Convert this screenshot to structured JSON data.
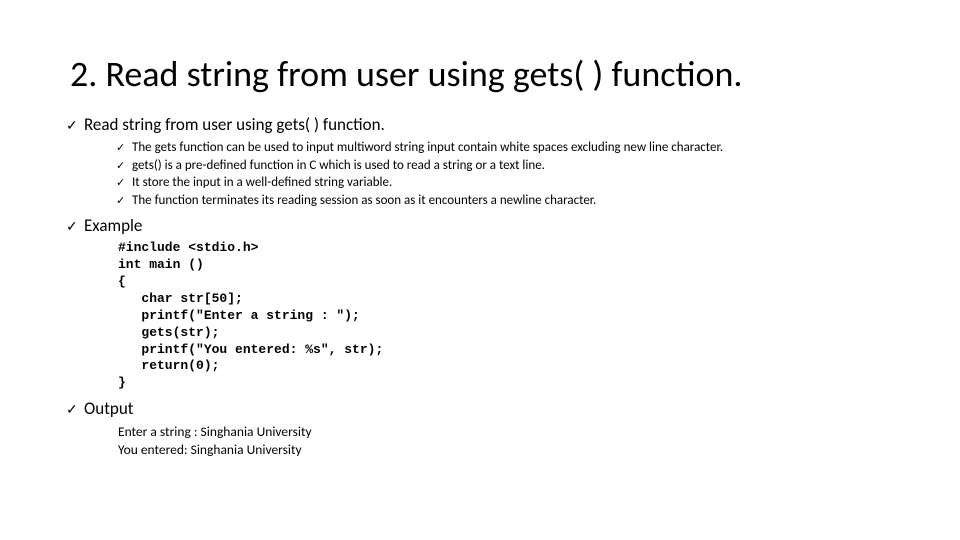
{
  "title": "2. Read string from user using gets( ) function.",
  "section1": {
    "heading": "Read string from user using gets( ) function.",
    "bullets": [
      "The gets function can be used to input multiword string input contain white spaces excluding new line character.",
      "gets() is a pre-defined function in C which is used to read a string or a text line.",
      "It store the input in a well-defined string variable.",
      "The function terminates its reading session as soon as it encounters a newline character."
    ]
  },
  "section2": {
    "heading": "Example",
    "code": "#include <stdio.h>\nint main ()\n{\n   char str[50];\n   printf(\"Enter a string : \");\n   gets(str);\n   printf(\"You entered: %s\", str);\n   return(0);\n}"
  },
  "section3": {
    "heading": "Output",
    "lines": [
      "Enter a string : Singhania University",
      "You entered: Singhania University"
    ]
  }
}
